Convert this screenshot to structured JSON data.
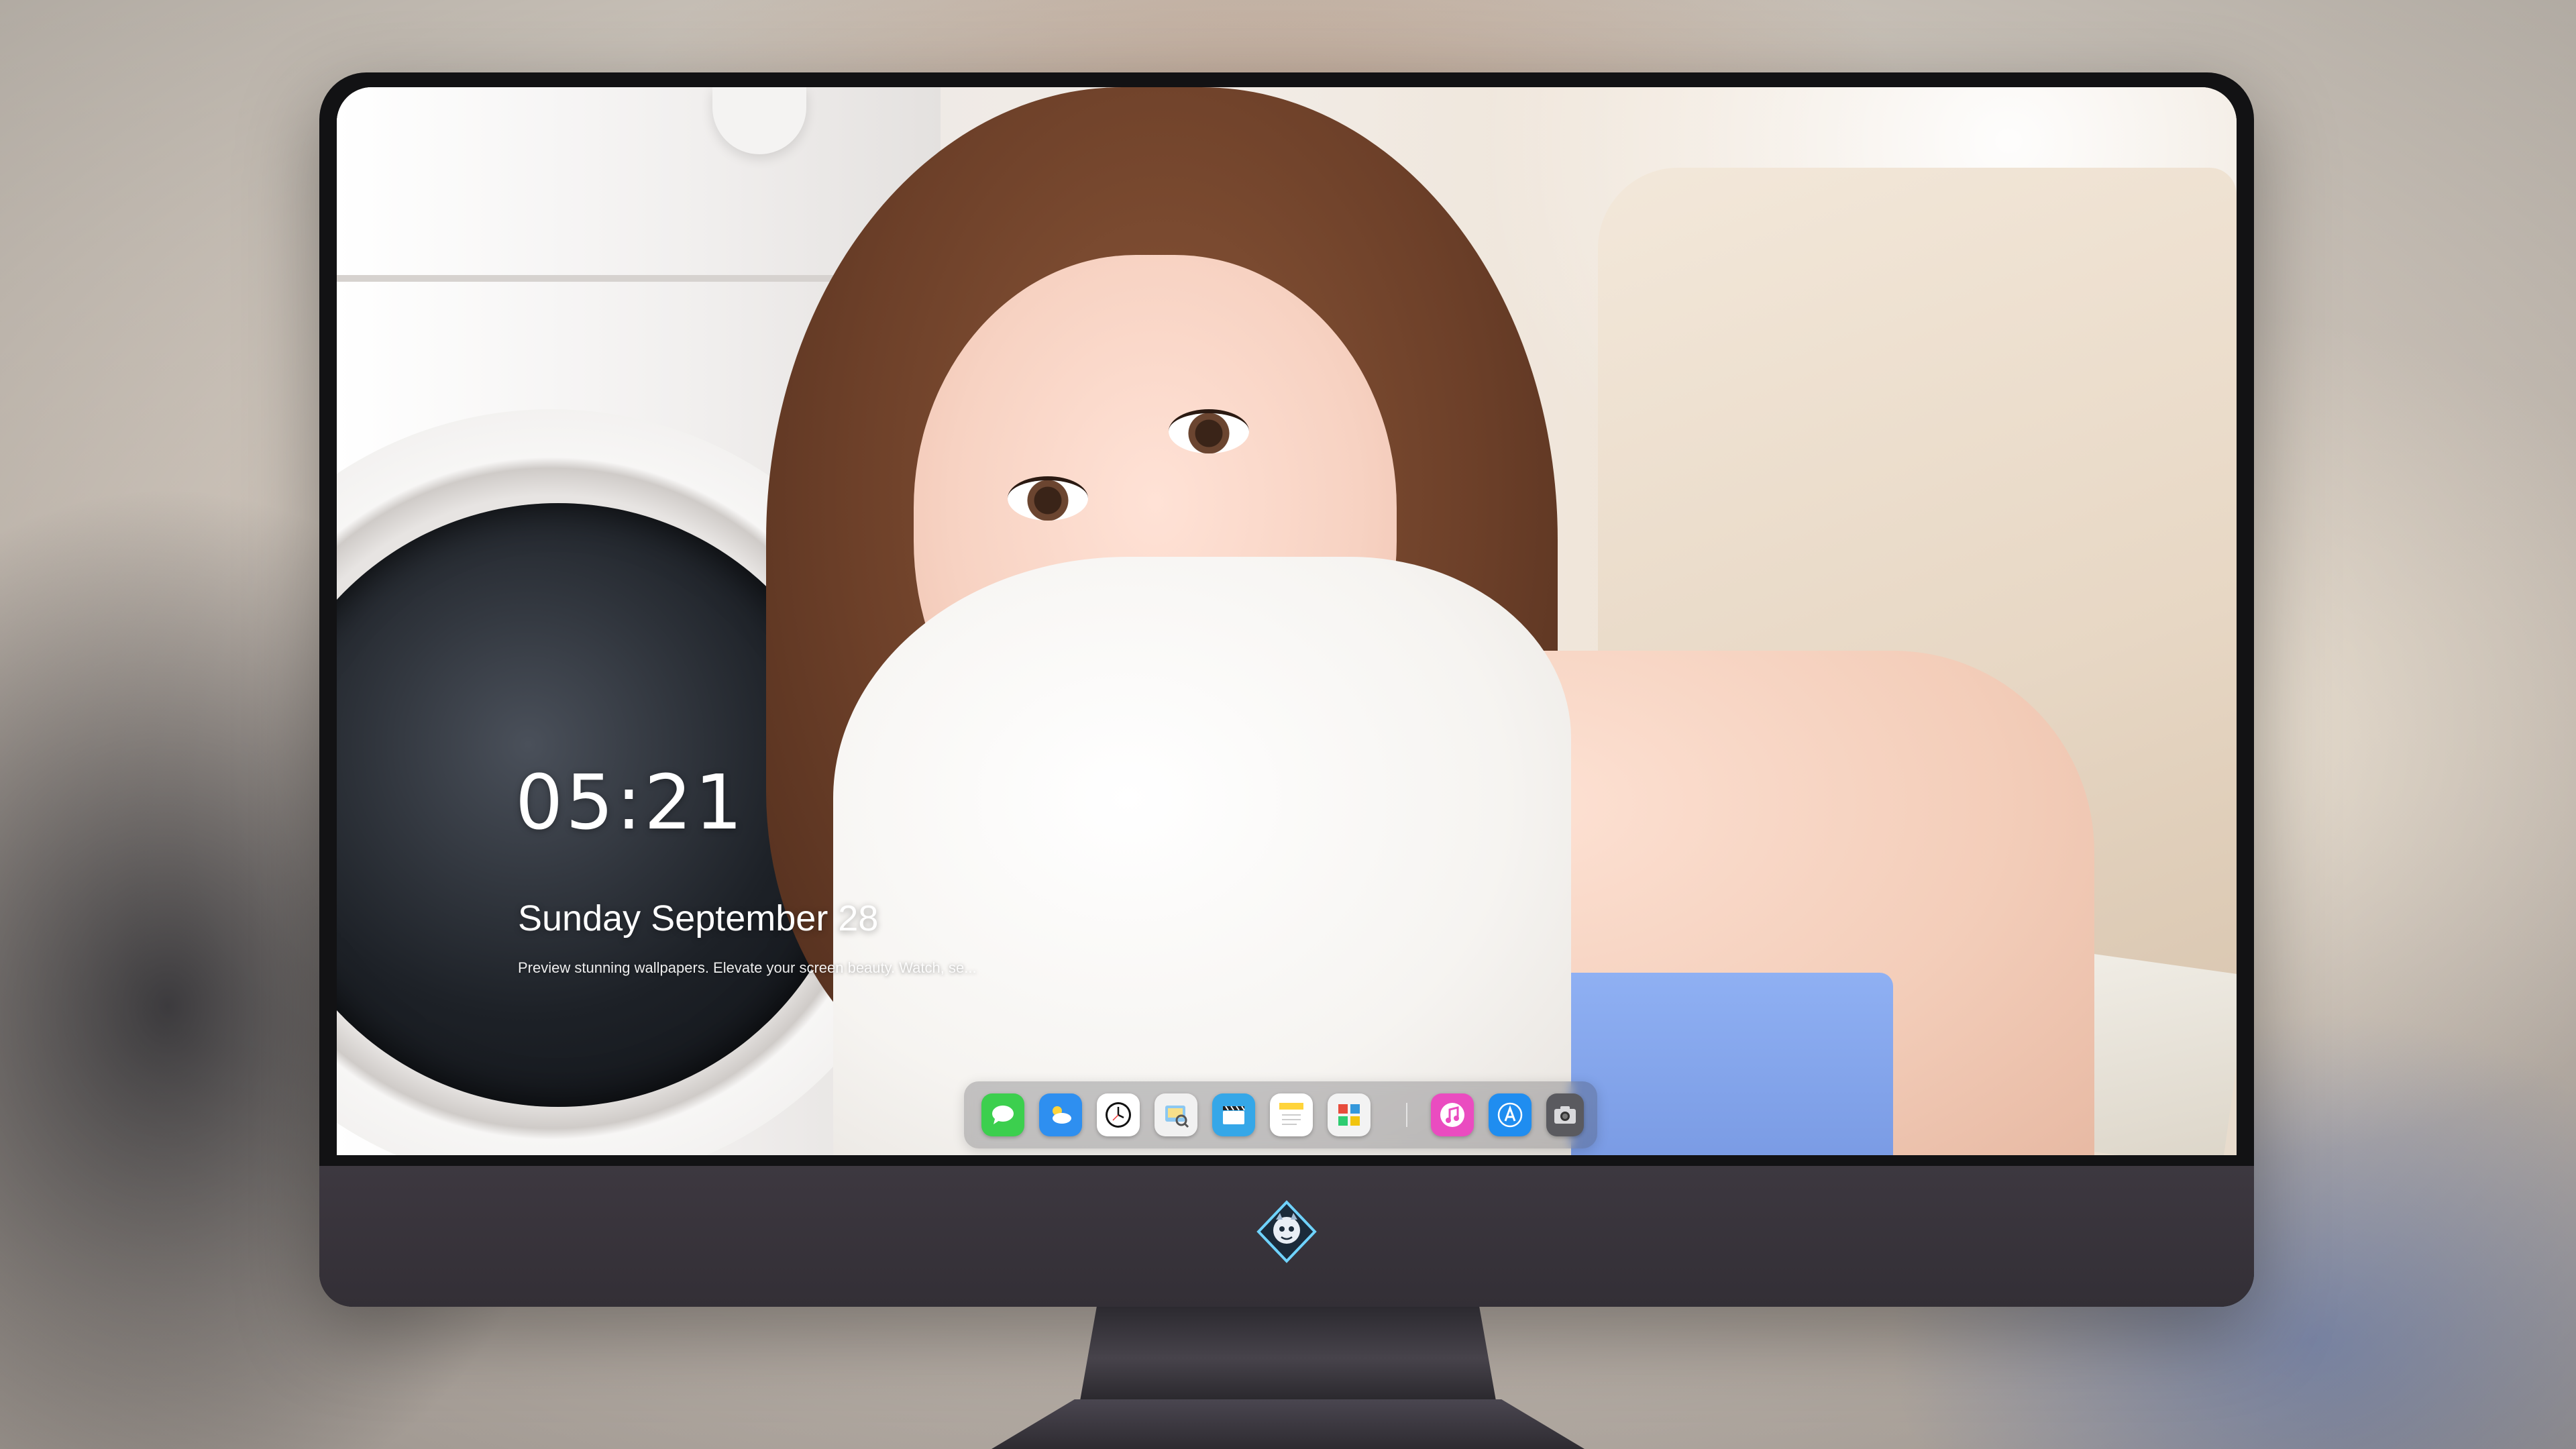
{
  "lockscreen": {
    "time": "05:21",
    "date": "Sunday September 28",
    "tagline": "Preview stunning wallpapers. Elevate your screen beauty. Watch, se..."
  },
  "dock": {
    "items": [
      {
        "id": "messages",
        "icon": "messages-icon",
        "color": "#3ccf4e"
      },
      {
        "id": "weather",
        "icon": "weather-icon",
        "color": "#2e8ff0"
      },
      {
        "id": "clock",
        "icon": "clock-icon",
        "color": "#ffffff"
      },
      {
        "id": "preview",
        "icon": "preview-icon",
        "color": "#f1f1f1"
      },
      {
        "id": "clips",
        "icon": "clips-icon",
        "color": "#35a7e8"
      },
      {
        "id": "notes",
        "icon": "notes-icon",
        "color": "#ffd43b"
      },
      {
        "id": "photo-booth",
        "icon": "photo-booth-icon",
        "color": "#f3f3f3"
      },
      {
        "id": "itunes",
        "icon": "itunes-icon",
        "color": "#ea4cc0"
      },
      {
        "id": "app-store",
        "icon": "app-store-icon",
        "color": "#1f8df0"
      },
      {
        "id": "camera",
        "icon": "camera-icon",
        "color": "#5a5a5f"
      }
    ]
  },
  "brand": {
    "logo": "dragon-mascot-logo"
  }
}
